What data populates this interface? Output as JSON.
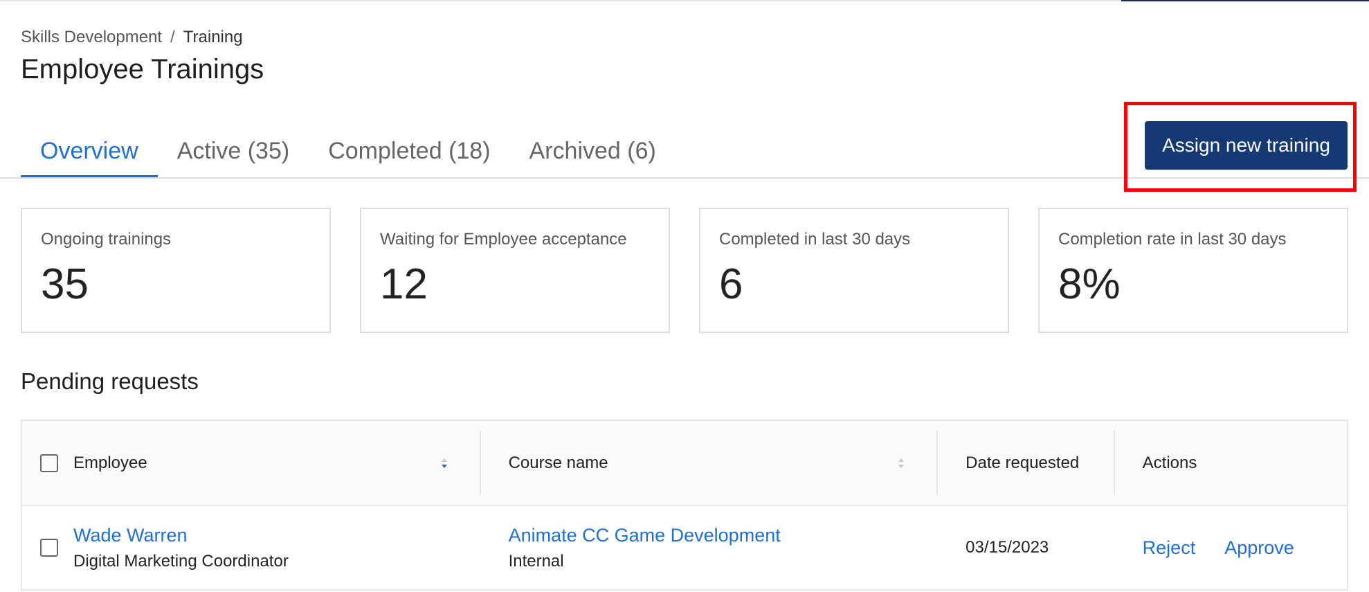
{
  "colors": {
    "primary": "#1f6fd1",
    "button_bg": "#153a73",
    "highlight": "#ff0000"
  },
  "breadcrumb": {
    "parent": "Skills Development",
    "separator": "/",
    "current": "Training"
  },
  "page_title": "Employee Trainings",
  "tabs": [
    {
      "label": "Overview",
      "active": true
    },
    {
      "label": "Active (35)",
      "active": false
    },
    {
      "label": "Completed (18)",
      "active": false
    },
    {
      "label": "Archived (6)",
      "active": false
    }
  ],
  "assign_button_label": "Assign new training",
  "cards": [
    {
      "label": "Ongoing trainings",
      "value": "35"
    },
    {
      "label": "Waiting for Employee acceptance",
      "value": "12"
    },
    {
      "label": "Completed in last 30 days",
      "value": "6"
    },
    {
      "label": "Completion rate in last 30 days",
      "value": "8%"
    }
  ],
  "pending": {
    "title": "Pending requests",
    "columns": {
      "employee": "Employee",
      "course": "Course name",
      "date": "Date requested",
      "actions": "Actions"
    },
    "rows": [
      {
        "employee_name": "Wade Warren",
        "employee_role": "Digital Marketing Coordinator",
        "course_name": "Animate CC Game Development",
        "course_type": "Internal",
        "date": "03/15/2023",
        "reject_label": "Reject",
        "approve_label": "Approve"
      }
    ]
  }
}
